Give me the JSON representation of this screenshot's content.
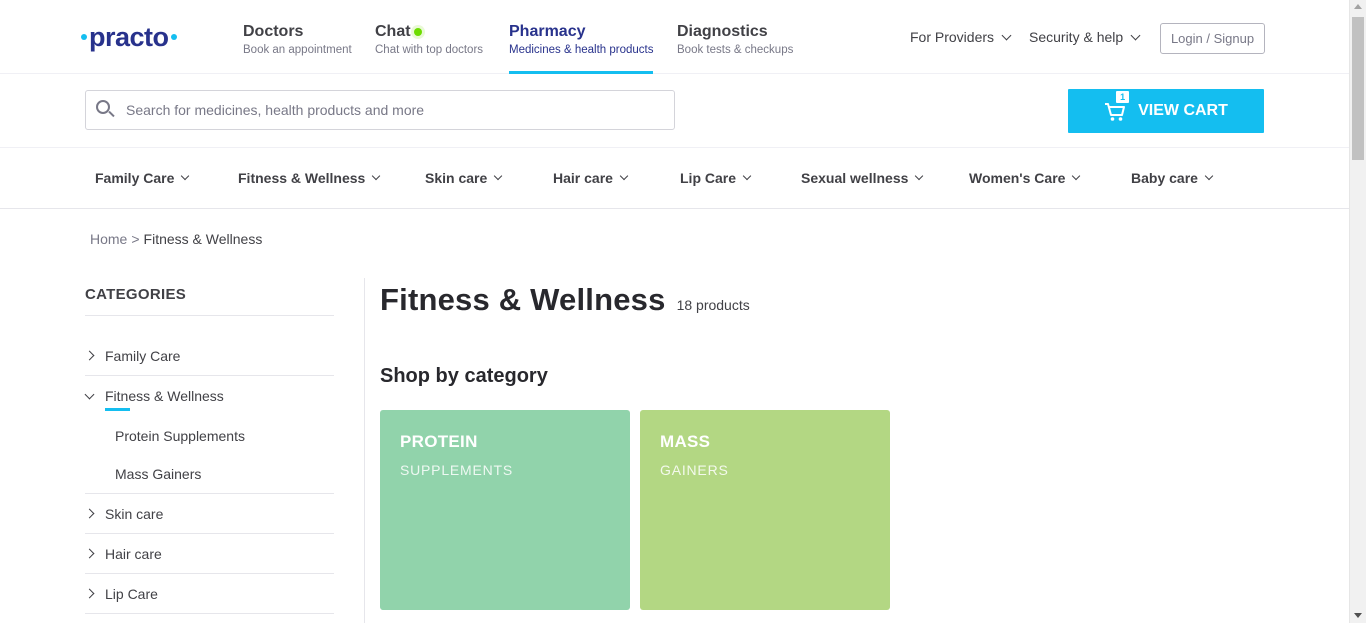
{
  "logo": {
    "text": "practo"
  },
  "header": {
    "nav": [
      {
        "title": "Doctors",
        "subtitle": "Book an appointment"
      },
      {
        "title": "Chat",
        "subtitle": "Chat with top doctors"
      },
      {
        "title": "Pharmacy",
        "subtitle": "Medicines & health products"
      },
      {
        "title": "Diagnostics",
        "subtitle": "Book tests & checkups"
      }
    ],
    "for_providers": "For Providers",
    "security_help": "Security & help",
    "login": "Login / Signup"
  },
  "search": {
    "placeholder": "Search for medicines, health products and more",
    "value": ""
  },
  "cart": {
    "label": "VIEW CART",
    "count": "1"
  },
  "categories_nav": [
    "Family Care",
    "Fitness & Wellness",
    "Skin care",
    "Hair care",
    "Lip Care",
    "Sexual wellness",
    "Women's Care",
    "Baby care"
  ],
  "breadcrumb": {
    "home": "Home",
    "separator": ">",
    "current": "Fitness & Wellness"
  },
  "sidebar": {
    "title": "CATEGORIES",
    "items": [
      "Family Care",
      "Fitness & Wellness",
      "Skin care",
      "Hair care",
      "Lip Care"
    ],
    "sub_items": [
      "Protein Supplements",
      "Mass Gainers"
    ]
  },
  "main": {
    "title": "Fitness & Wellness",
    "count": "18 products",
    "shop_by": "Shop by category",
    "tiles": [
      {
        "line1": "PROTEIN",
        "line2": "SUPPLEMENTS",
        "color": "#91d3ab"
      },
      {
        "line1": "MASS",
        "line2": "GAINERS",
        "color": "#b3d783"
      }
    ]
  },
  "colors": {
    "brand_blue": "#14bef0",
    "brand_navy": "#28328c",
    "online_green": "#6ddc00"
  }
}
